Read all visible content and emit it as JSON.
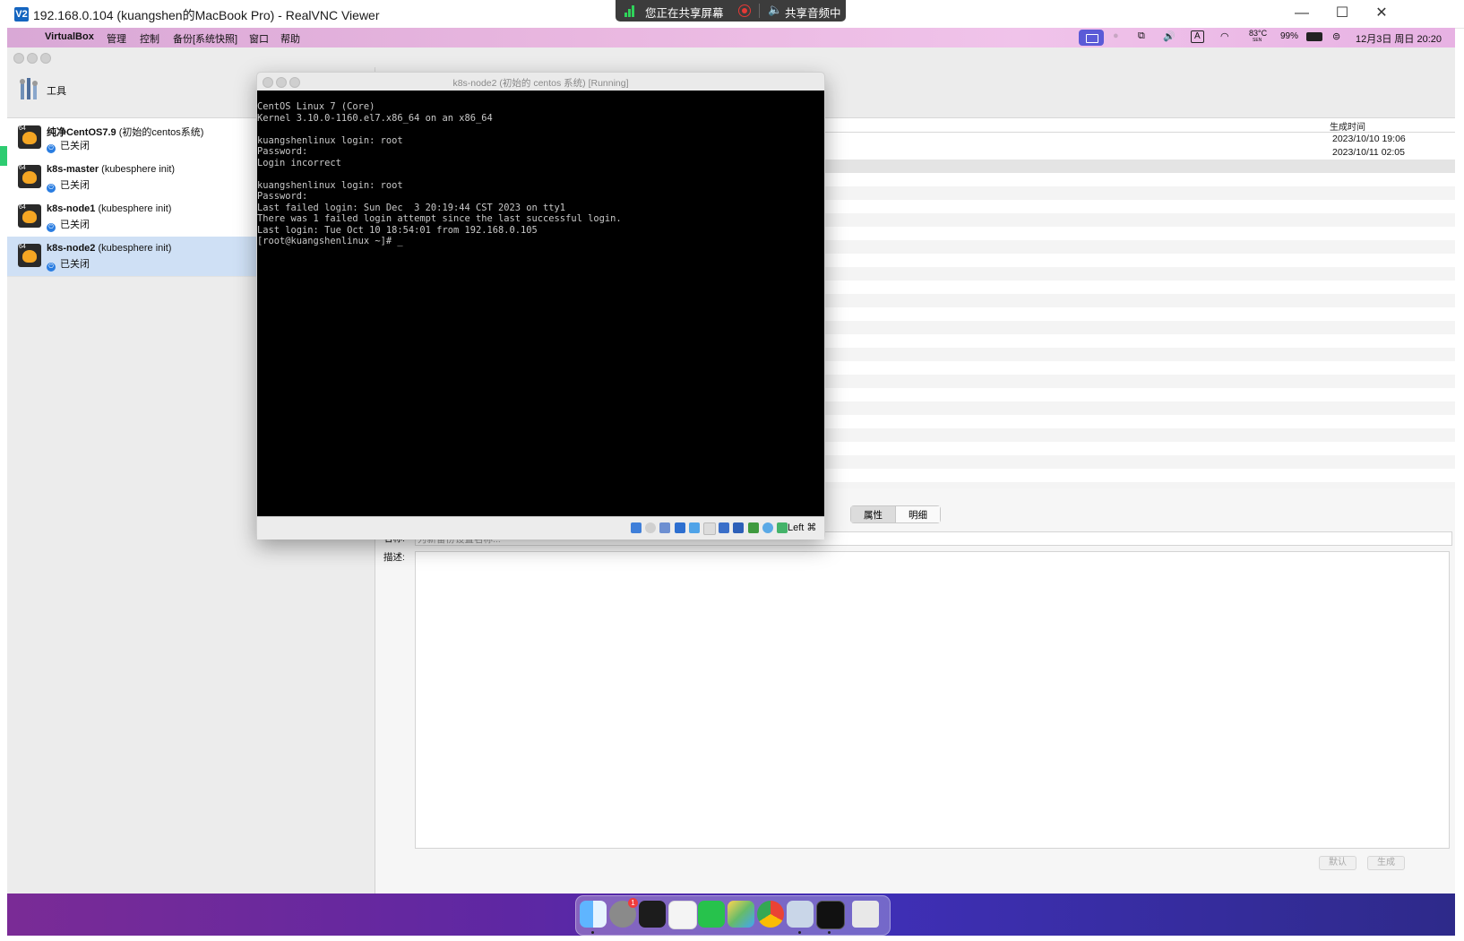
{
  "vnc": {
    "title": "192.168.0.104 (kuangshen的MacBook Pro) - RealVNC Viewer",
    "app_icon": "V2",
    "minimize_glyph": "—",
    "maximize_glyph": "☐",
    "close_glyph": "✕"
  },
  "share_banner": {
    "sharing_text": "您正在共享屏幕",
    "audio_text": "共享音频中",
    "speaker_glyph": "🔈"
  },
  "mac_menubar": {
    "apple_glyph": "",
    "app_name": "VirtualBox",
    "menus": [
      "管理",
      "控制",
      "备份[系统快照]",
      "窗口",
      "帮助"
    ],
    "status": {
      "temperature": "83°C",
      "temperature_sub": "SEN",
      "battery": "99%",
      "datetime": "12月3日 周日  20:20",
      "input_method": "A"
    }
  },
  "vbox": {
    "tools_label": "工具",
    "vms": [
      {
        "name": "纯净CentOS7.9",
        "note": "(初始的centos系统)",
        "state": "已关闭"
      },
      {
        "name": "k8s-master",
        "note": "(kubesphere init)",
        "state": "已关闭"
      },
      {
        "name": "k8s-node1",
        "note": "(kubesphere init)",
        "state": "已关闭"
      },
      {
        "name": "k8s-node2",
        "note": "(kubesphere init)",
        "state": "已关闭"
      }
    ],
    "snapshots": {
      "column_header": "生成时间",
      "times": [
        "2023/10/10 19:06",
        "2023/10/11 02:05"
      ]
    },
    "details": {
      "tabs": [
        "属性",
        "明细"
      ],
      "name_label": "名称:",
      "name_placeholder": "为新备份设置名称...",
      "desc_label": "描述:",
      "btn_reset": "默认",
      "btn_create": "生成"
    }
  },
  "vm_window": {
    "title": "k8s-node2 (初始的 centos 系统) [Running]",
    "console_lines": [
      "CentOS Linux 7 (Core)",
      "Kernel 3.10.0-1160.el7.x86_64 on an x86_64",
      "",
      "kuangshenlinux login: root",
      "Password:",
      "Login incorrect",
      "",
      "kuangshenlinux login: root",
      "Password:",
      "Last failed login: Sun Dec  3 20:19:44 CST 2023 on tty1",
      "There was 1 failed login attempt since the last successful login.",
      "Last login: Tue Oct 10 18:54:01 from 192.168.0.105",
      "[root@kuangshenlinux ~]# _"
    ],
    "host_key": "Left ⌘"
  },
  "dock": {
    "apps": [
      "finder",
      "system-settings",
      "terminal",
      "wps-office",
      "wechat",
      "photos",
      "chrome",
      "virtualbox",
      "vm-console",
      "trash"
    ],
    "badge": "1"
  },
  "colors": {
    "menubar_accent": "#5a5ad7",
    "selected_row": "#cfe0f5",
    "console_bg": "#000000",
    "console_fg": "#c8c8c8"
  }
}
